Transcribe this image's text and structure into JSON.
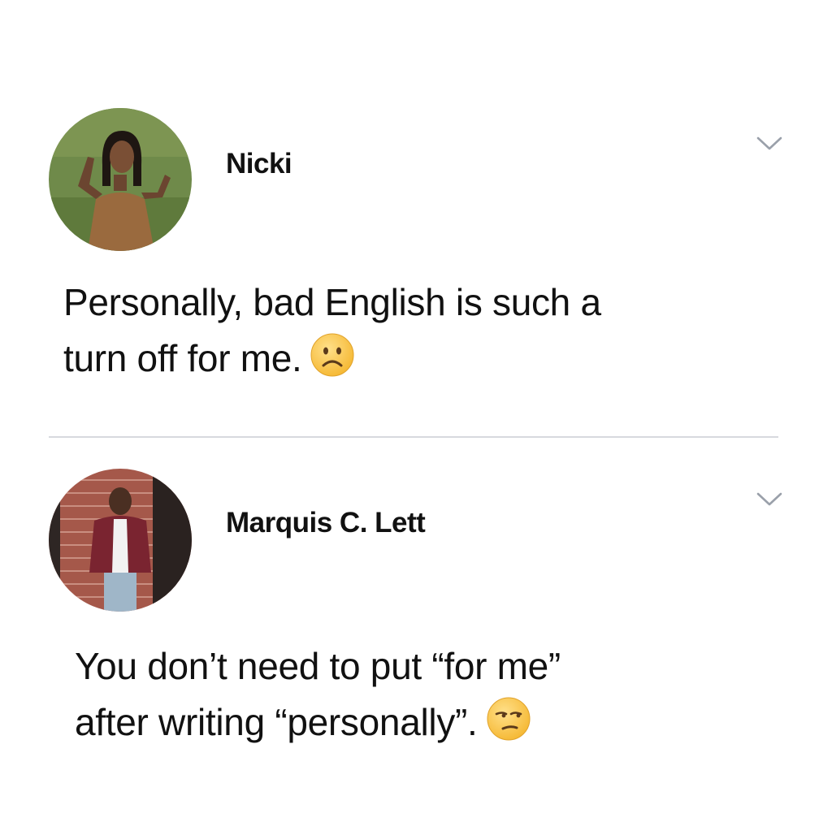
{
  "posts": [
    {
      "author": "Nicki",
      "avatar_icon": "profile-photo-woman-grass",
      "menu_icon": "chevron-down-icon",
      "text_lines": [
        "Personally, bad English is such a",
        "turn off for me."
      ],
      "emoji": "frowning-face-emoji"
    },
    {
      "author": "Marquis C. Lett",
      "avatar_icon": "profile-photo-man-brick-wall",
      "menu_icon": "chevron-down-icon",
      "text_lines": [
        "You don’t need to put “for me”",
        "after writing “personally”."
      ],
      "emoji": "unamused-face-emoji"
    }
  ],
  "colors": {
    "text": "#111111",
    "chevron": "#9aa0aa",
    "divider": "#d7d9de",
    "emoji_face": "#f9c94a"
  }
}
